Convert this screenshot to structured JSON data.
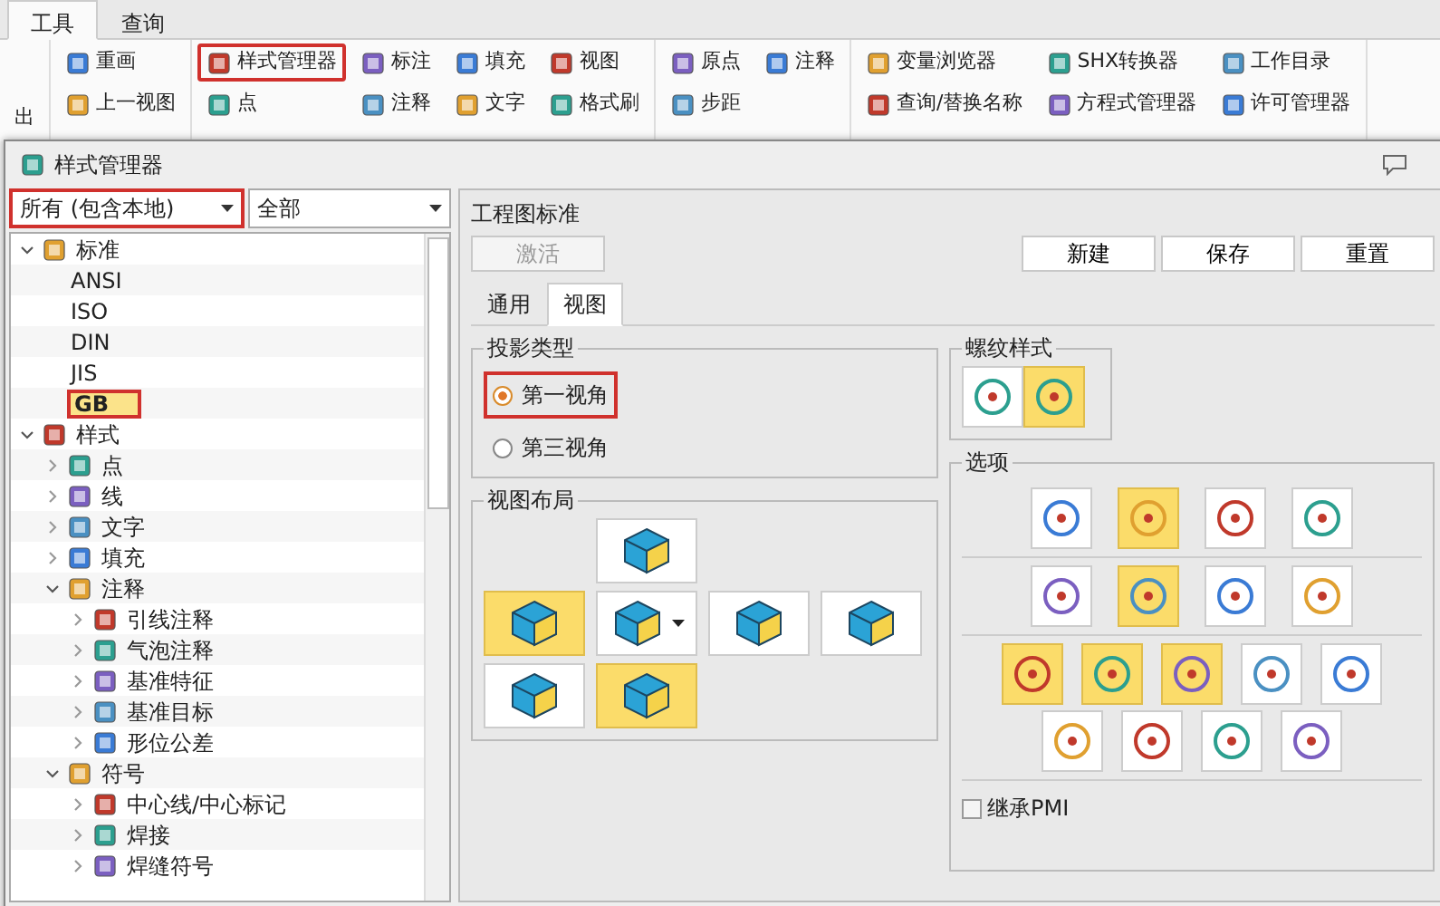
{
  "ribbon": {
    "tabs": [
      {
        "label": "工具",
        "selected": true
      },
      {
        "label": "查询",
        "selected": false
      }
    ],
    "groups": [
      {
        "columns": [
          {
            "items": [
              {
                "label": "出",
                "annotated": false
              }
            ]
          }
        ]
      },
      {
        "columns": [
          {
            "items": [
              {
                "label": "重画",
                "annotated": false
              },
              {
                "label": "上一视图",
                "annotated": false
              }
            ]
          }
        ]
      },
      {
        "columns": [
          {
            "items": [
              {
                "label": "样式管理器",
                "annotated": true
              },
              {
                "label": "点",
                "annotated": false
              }
            ]
          },
          {
            "items": [
              {
                "label": "标注",
                "annotated": false
              },
              {
                "label": "注释",
                "annotated": false
              }
            ]
          },
          {
            "items": [
              {
                "label": "填充",
                "annotated": false
              },
              {
                "label": "文字",
                "annotated": false
              }
            ]
          },
          {
            "items": [
              {
                "label": "视图",
                "annotated": false
              },
              {
                "label": "格式刷",
                "annotated": false
              }
            ]
          }
        ]
      },
      {
        "columns": [
          {
            "items": [
              {
                "label": "原点",
                "annotated": false
              },
              {
                "label": "步距",
                "annotated": false
              }
            ]
          },
          {
            "items": [
              {
                "label": "注释",
                "annotated": false
              }
            ]
          }
        ]
      },
      {
        "columns": [
          {
            "items": [
              {
                "label": "变量浏览器",
                "annotated": false
              },
              {
                "label": "查询/替换名称",
                "annotated": false
              }
            ]
          },
          {
            "items": [
              {
                "label": "SHX转换器",
                "annotated": false
              },
              {
                "label": "方程式管理器",
                "annotated": false
              }
            ]
          },
          {
            "items": [
              {
                "label": "工作目录",
                "annotated": false
              },
              {
                "label": "许可管理器",
                "annotated": false
              }
            ]
          }
        ]
      }
    ]
  },
  "dialog": {
    "title": "样式管理器",
    "filters": [
      {
        "value": "所有 (包含本地)",
        "annotated": true
      },
      {
        "value": "全部",
        "annotated": false
      }
    ],
    "tree": [
      {
        "label": "标准",
        "expanded": true,
        "children": [
          {
            "label": "ANSI",
            "selected": false,
            "annotated": false
          },
          {
            "label": "ISO",
            "selected": false,
            "annotated": false
          },
          {
            "label": "DIN",
            "selected": false,
            "annotated": false
          },
          {
            "label": "JIS",
            "selected": false,
            "annotated": false
          },
          {
            "label": "GB",
            "selected": true,
            "annotated": true
          }
        ]
      },
      {
        "label": "样式",
        "expanded": true,
        "children": [
          {
            "label": "点",
            "expanded": false
          },
          {
            "label": "线",
            "expanded": false
          },
          {
            "label": "文字",
            "expanded": false
          },
          {
            "label": "填充",
            "expanded": false
          },
          {
            "label": "注释",
            "expanded": true,
            "children": [
              {
                "label": "引线注释",
                "expanded": false
              },
              {
                "label": "气泡注释",
                "expanded": false
              },
              {
                "label": "基准特征",
                "expanded": false
              },
              {
                "label": "基准目标",
                "expanded": false
              },
              {
                "label": "形位公差",
                "expanded": false
              }
            ]
          },
          {
            "label": "符号",
            "expanded": true,
            "children": [
              {
                "label": "中心线/中心标记",
                "expanded": false
              },
              {
                "label": "焊接",
                "expanded": false
              },
              {
                "label": "焊缝符号",
                "expanded": false
              }
            ]
          }
        ]
      }
    ],
    "standard": {
      "title": "工程图标准",
      "buttons": [
        {
          "label": "激活",
          "disabled": true
        },
        {
          "label": "新建",
          "disabled": false
        },
        {
          "label": "保存",
          "disabled": false
        },
        {
          "label": "重置",
          "disabled": false
        }
      ]
    },
    "tabs": [
      {
        "label": "通用",
        "selected": false
      },
      {
        "label": "视图",
        "selected": true
      }
    ],
    "projection": {
      "title": "投影类型",
      "options": [
        {
          "label": "第一视角",
          "selected": true,
          "annotated": true
        },
        {
          "label": "第三视角",
          "selected": false,
          "annotated": false
        }
      ]
    },
    "layout": {
      "title": "视图布局",
      "rows": [
        [
          {
            "selected": false
          }
        ],
        [
          {
            "selected": true
          },
          {
            "selected": false,
            "dropdown": true
          },
          {
            "selected": false
          },
          {
            "selected": false
          }
        ],
        [
          {
            "selected": false
          },
          {
            "selected": true
          }
        ]
      ]
    },
    "thread_style": {
      "title": "螺纹样式",
      "buttons": [
        {
          "selected": false
        },
        {
          "selected": true
        }
      ]
    },
    "options": {
      "title": "选项",
      "rows": [
        [
          {
            "selected": false
          },
          {
            "selected": true
          },
          {
            "selected": false
          },
          {
            "selected": false
          }
        ],
        [
          {
            "selected": false
          },
          {
            "selected": true
          },
          {
            "selected": false
          },
          {
            "selected": false
          }
        ],
        [
          {
            "selected": true
          },
          {
            "selected": true
          },
          {
            "selected": true
          },
          {
            "selected": false
          },
          {
            "selected": false
          },
          {
            "selected": false
          },
          {
            "selected": false
          },
          {
            "selected": false
          },
          {
            "selected": false
          }
        ]
      ],
      "checkbox": {
        "label": "继承PMI",
        "checked": false
      }
    }
  }
}
